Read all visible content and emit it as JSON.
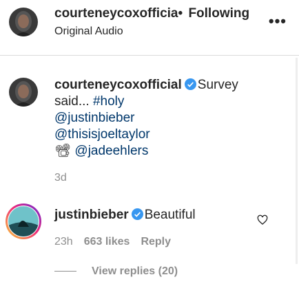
{
  "header": {
    "username": "courteneycoxofficia",
    "follow_label": "Following",
    "separator": "•",
    "subtitle": "Original Audio",
    "more_label": "•••"
  },
  "caption": {
    "username": "courteneycoxofficial",
    "text_line1": "Survey",
    "text_line2_a": "said... ",
    "hashtag": "#holy",
    "mention1": "@justinbieber",
    "mention2": "@thisisjoeltaylor",
    "camera_emoji": "📽",
    "mention3": "@jadeehlers",
    "time": "3d"
  },
  "comment": {
    "username": "justinbieber",
    "text": "Beautiful",
    "time": "23h",
    "likes": "663 likes",
    "reply_label": "Reply",
    "view_replies": "View replies (20)"
  },
  "colors": {
    "verified": "#3897f0",
    "link": "#00376b",
    "muted": "#8e8e8e"
  },
  "icons": [
    "avatar",
    "verified-icon",
    "more-icon",
    "heart-icon"
  ]
}
